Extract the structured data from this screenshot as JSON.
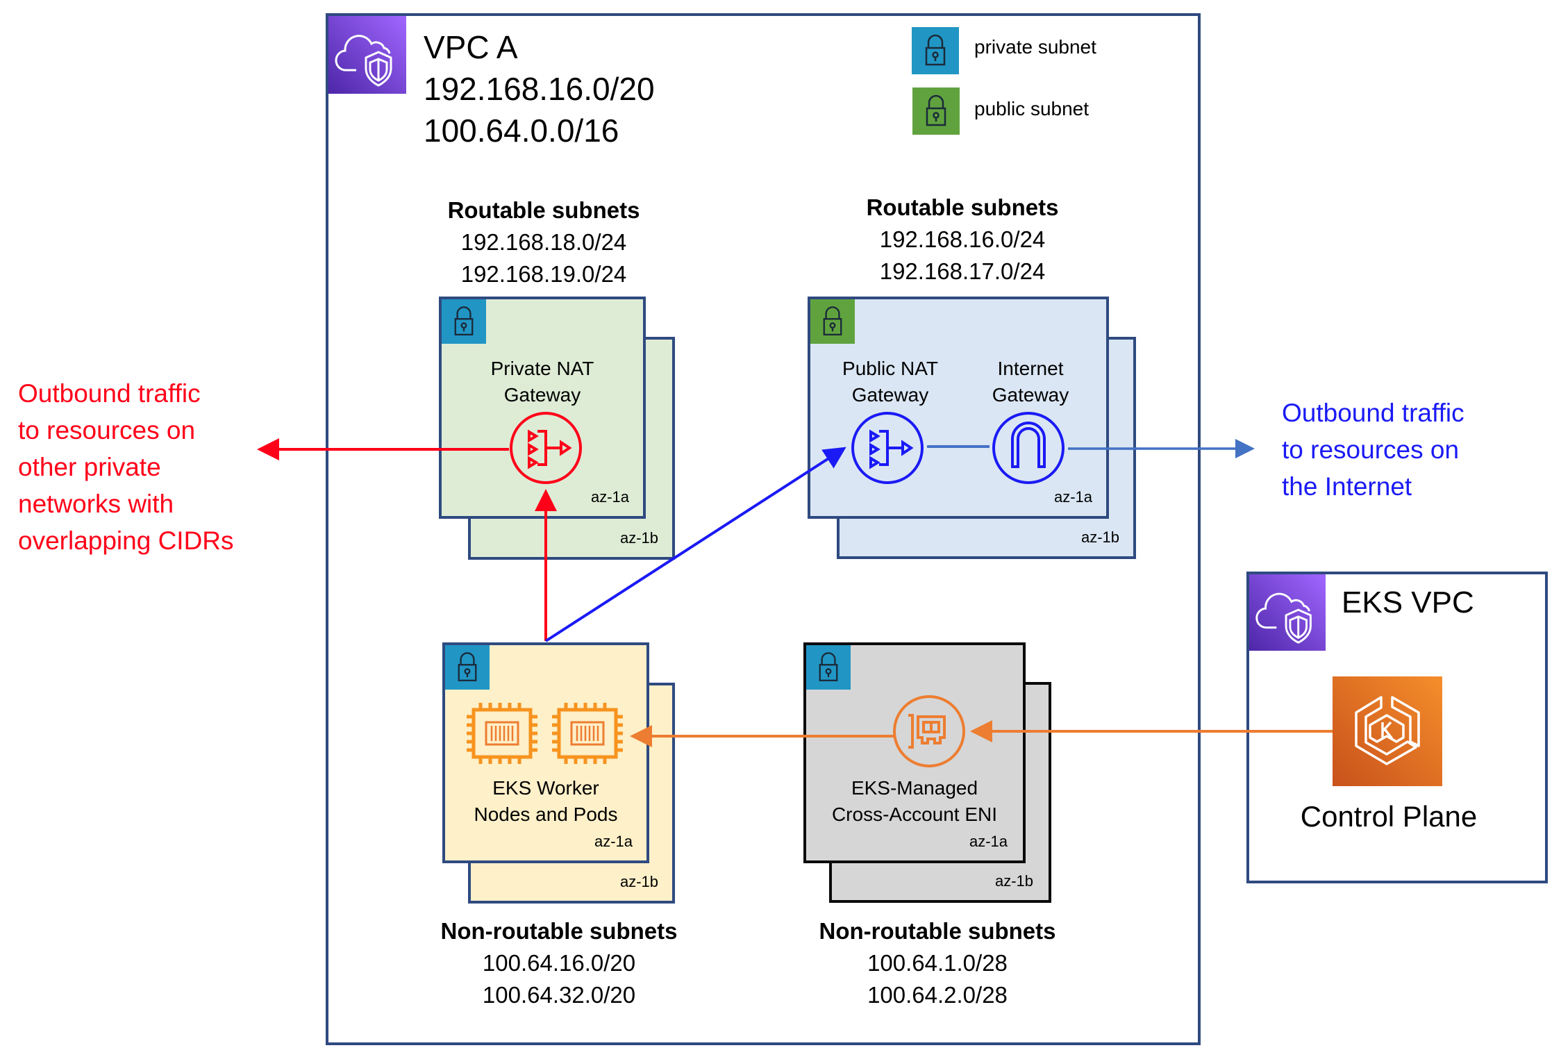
{
  "vpc_a": {
    "title": "VPC A",
    "cidrs": [
      "192.168.16.0/20",
      "100.64.0.0/16"
    ],
    "icon": "vpc-cloud-shield-icon"
  },
  "legend": {
    "private": {
      "label": "private subnet",
      "icon": "lock-icon",
      "color": "#2196C4"
    },
    "public": {
      "label": "public subnet",
      "icon": "lock-icon",
      "color": "#60A33E"
    }
  },
  "routable_private": {
    "header": "Routable subnets",
    "cidrs": [
      "192.168.18.0/24",
      "192.168.19.0/24"
    ],
    "component": [
      "Private NAT",
      "Gateway"
    ],
    "az_front": "az-1a",
    "az_back": "az-1b",
    "fill": "#DEECD6"
  },
  "routable_public": {
    "header": "Routable subnets",
    "cidrs": [
      "192.168.16.0/24",
      "192.168.17.0/24"
    ],
    "components": [
      {
        "label": [
          "Public NAT",
          "Gateway"
        ],
        "icon": "nat-gateway-icon"
      },
      {
        "label": [
          "Internet",
          "Gateway"
        ],
        "icon": "internet-gateway-icon"
      }
    ],
    "az_front": "az-1a",
    "az_back": "az-1b",
    "fill": "#DAE6F3"
  },
  "nonroutable_workers": {
    "header": "Non-routable subnets",
    "cidrs": [
      "100.64.16.0/20",
      "100.64.32.0/20"
    ],
    "component": [
      "EKS Worker",
      "Nodes and Pods"
    ],
    "az_front": "az-1a",
    "az_back": "az-1b",
    "fill": "#FEF0C9"
  },
  "nonroutable_eni": {
    "header": "Non-routable subnets",
    "cidrs": [
      "100.64.1.0/28",
      "100.64.2.0/28"
    ],
    "component": [
      "EKS-Managed",
      "Cross-Account ENI"
    ],
    "az_front": "az-1a",
    "az_back": "az-1b",
    "fill": "#D6D6D6"
  },
  "eks_vpc": {
    "title": "EKS VPC",
    "component": "Control Plane",
    "icon": "eks-icon"
  },
  "callouts": {
    "private_outbound": [
      "Outbound traffic",
      "to resources on",
      "other private",
      "networks with",
      "overlapping CIDRs"
    ],
    "internet_outbound": [
      "Outbound traffic",
      "to resources on",
      "the Internet"
    ]
  },
  "colors": {
    "vpc_border": "#2F4A80",
    "private_flow": "#FF0019",
    "public_flow": "#1A1AF5",
    "internet_link": "#4472C4",
    "eks_flow": "#ED7D31",
    "compute": "#F7931E"
  }
}
